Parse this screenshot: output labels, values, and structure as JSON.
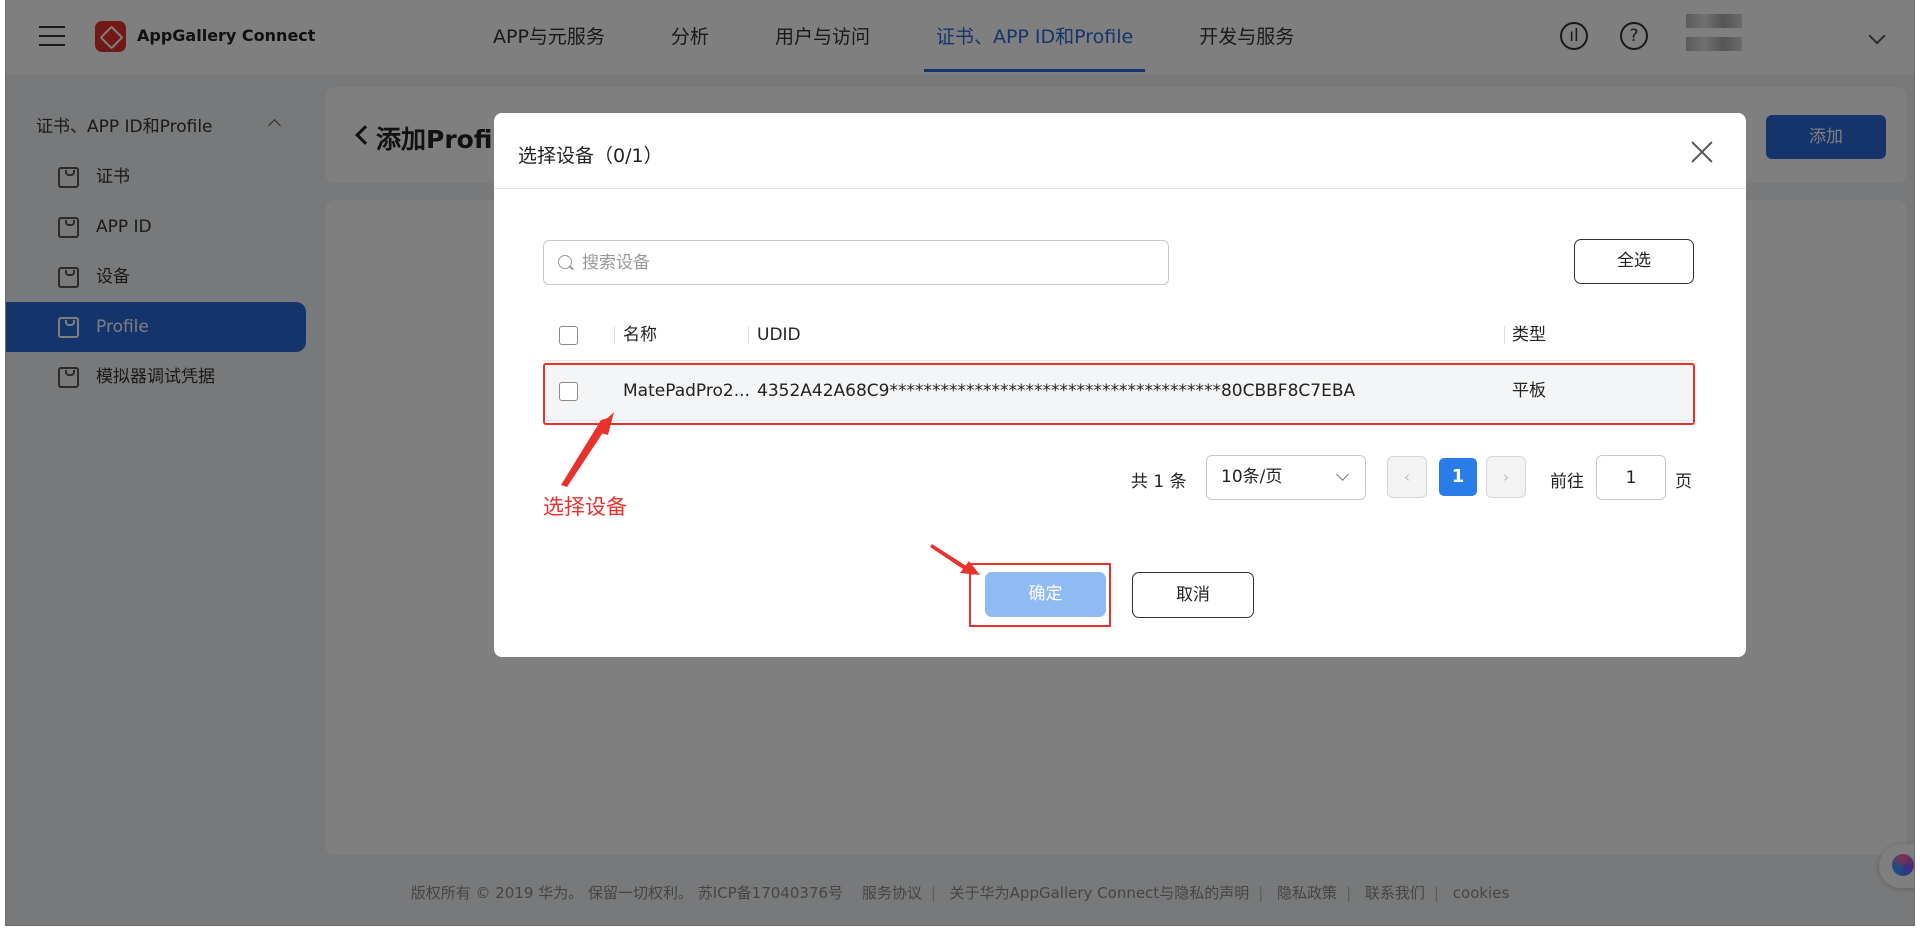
{
  "header": {
    "app_name": "AppGallery Connect",
    "nav": [
      "APP与元服务",
      "分析",
      "用户与访问",
      "证书、APP ID和Profile",
      "开发与服务"
    ],
    "active_nav_index": 3,
    "help_glyph": "?",
    "accent_color": "#2a68d6"
  },
  "sidebar": {
    "group_title": "证书、APP ID和Profile",
    "items": [
      {
        "label": "证书",
        "icon": "folder-icon"
      },
      {
        "label": "APP ID",
        "icon": "folder-icon"
      },
      {
        "label": "设备",
        "icon": "folder-icon"
      },
      {
        "label": "Profile",
        "icon": "folder-icon",
        "active": true
      },
      {
        "label": "模拟器调试凭据",
        "icon": "folder-icon"
      }
    ]
  },
  "page": {
    "title": "添加Profile",
    "add_button": "添加"
  },
  "footer": {
    "copyright": "版权所有 © 2019 华为。 保留一切权利。 苏ICP备17040376号",
    "links": [
      "服务协议",
      "关于华为AppGallery Connect与隐私的声明",
      "隐私政策",
      "联系我们",
      "cookies"
    ]
  },
  "modal": {
    "title": "选择设备（0/1）",
    "search_placeholder": "搜索设备",
    "select_all": "全选",
    "columns": [
      "名称",
      "UDID",
      "类型"
    ],
    "rows": [
      {
        "name": "MatePadPro2...",
        "udid": "4352A42A68C9***************************************80CBBF8C7EBA",
        "type": "平板"
      }
    ],
    "pagination": {
      "total_text": "共 1 条",
      "page_size": "10条/页",
      "prev_glyph": "‹",
      "next_glyph": "›",
      "current_page": "1",
      "goto_label": "前往",
      "goto_value": "1",
      "goto_suffix": "页"
    },
    "confirm": "确定",
    "cancel": "取消"
  },
  "annotations": {
    "select_device_label": "选择设备",
    "color": "#e8322c"
  }
}
